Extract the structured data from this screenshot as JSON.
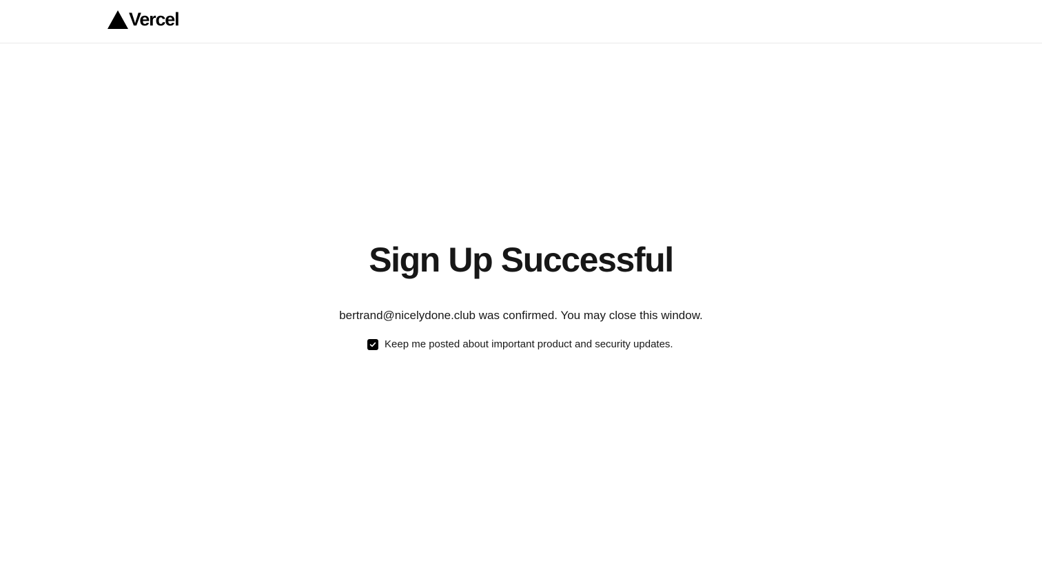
{
  "header": {
    "logo_text": "Vercel",
    "logo_icon": "vercel-triangle-icon"
  },
  "main": {
    "title": "Sign Up Successful",
    "message": "bertrand@nicelydone.club was confirmed. You may close this window.",
    "optin": {
      "checked": true,
      "icon": "check-icon",
      "label": "Keep me posted about important product and security updates."
    }
  },
  "colors": {
    "text": "#171717",
    "brand": "#000000",
    "border": "#eaeaea",
    "background": "#ffffff"
  }
}
